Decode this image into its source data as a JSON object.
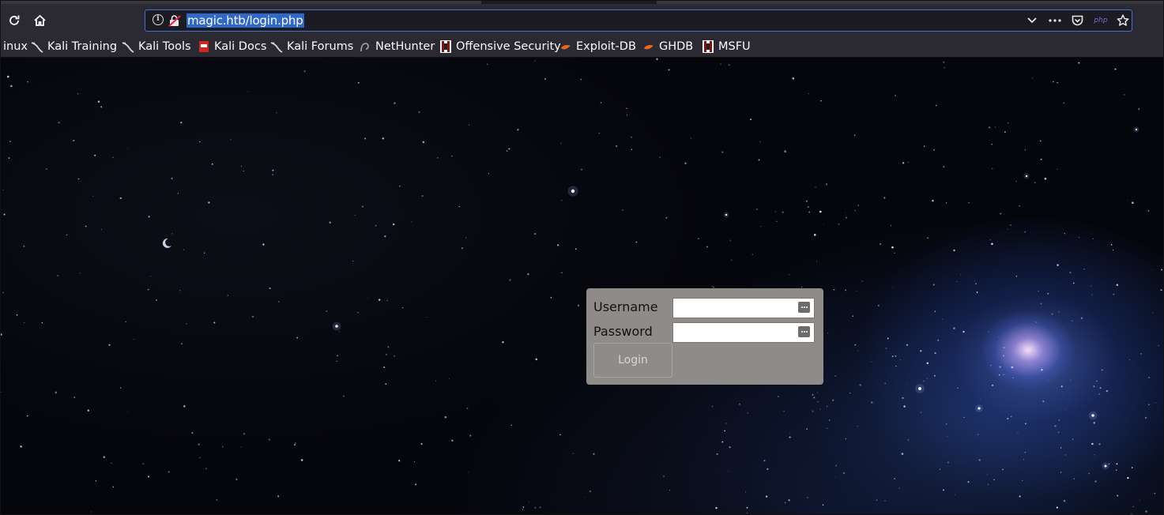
{
  "browser": {
    "url": "magic.htb/login.php",
    "url_php_badge": "php",
    "toolbar_icons": [
      "reload-icon",
      "home-icon",
      "info-icon",
      "insecure-lock-icon",
      "chevron-down-icon",
      "more-icon",
      "pocket-icon",
      "star-icon"
    ]
  },
  "bookmarks": [
    {
      "label": "inux",
      "icon": "kali-dragon-icon"
    },
    {
      "label": "Kali Training",
      "icon": "kali-dragon-icon"
    },
    {
      "label": "Kali Tools",
      "icon": "kali-dragon-icon"
    },
    {
      "label": "Kali Docs",
      "icon": "kali-docs-icon"
    },
    {
      "label": "Kali Forums",
      "icon": "kali-dragon-icon"
    },
    {
      "label": "NetHunter",
      "icon": "nethunter-icon"
    },
    {
      "label": "Offensive Security",
      "icon": "offsec-icon"
    },
    {
      "label": "Exploit-DB",
      "icon": "exploitdb-icon"
    },
    {
      "label": "GHDB",
      "icon": "exploitdb-icon"
    },
    {
      "label": "MSFU",
      "icon": "offsec-icon"
    }
  ],
  "login": {
    "username_label": "Username",
    "password_label": "Password",
    "username_value": "",
    "password_value": "",
    "button_label": "Login"
  },
  "colors": {
    "toolbar_bg": "#2b2a33",
    "url_highlight": "#2f68c8",
    "login_panel": "#8f8b88"
  }
}
